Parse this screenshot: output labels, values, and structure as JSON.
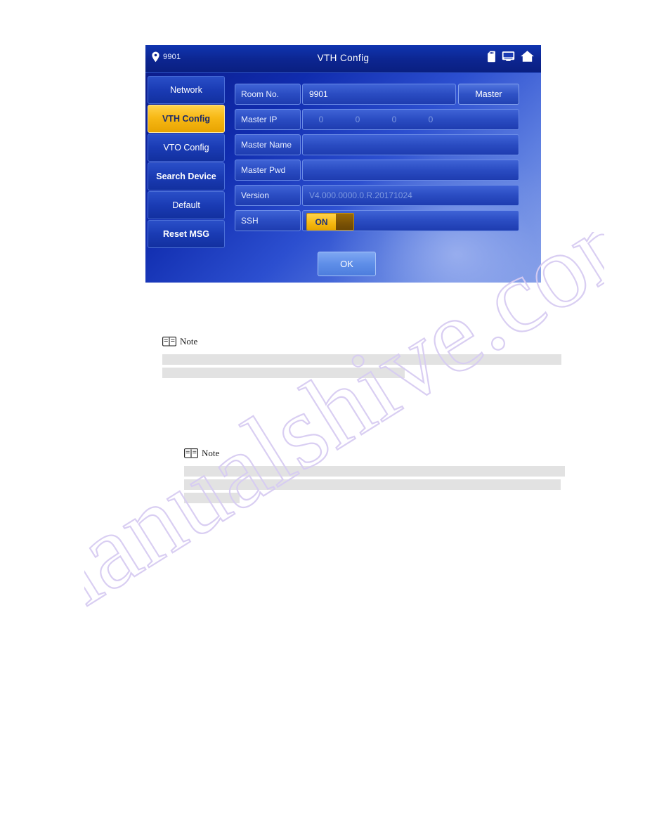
{
  "device": {
    "titlebar": {
      "room_number": "9901",
      "title": "VTH Config",
      "icons": [
        "sd-card-icon",
        "monitor-icon",
        "home-icon"
      ]
    },
    "menu": [
      {
        "label": "Network",
        "active": false,
        "bold": false
      },
      {
        "label": "VTH Config",
        "active": true,
        "bold": false
      },
      {
        "label": "VTO Config",
        "active": false,
        "bold": false
      },
      {
        "label": "Search Device",
        "active": false,
        "bold": true
      },
      {
        "label": "Default",
        "active": false,
        "bold": false
      },
      {
        "label": "Reset MSG",
        "active": false,
        "bold": true
      }
    ],
    "form": {
      "room_no": {
        "label": "Room No.",
        "value": "9901"
      },
      "master_button": "Master",
      "master_ip": {
        "label": "Master IP",
        "octets": [
          "0",
          "0",
          "0",
          "0"
        ]
      },
      "master_name": {
        "label": "Master Name",
        "value": ""
      },
      "master_pwd": {
        "label": "Master Pwd",
        "value": ""
      },
      "version": {
        "label": "Version",
        "value": "V4.000.0000.0.R.20171024"
      },
      "ssh": {
        "label": "SSH",
        "state": "ON"
      }
    },
    "ok_button": "OK"
  },
  "notes": [
    {
      "word": "Note"
    },
    {
      "word": "Note"
    }
  ],
  "watermark": {
    "text": "manualshive.com"
  },
  "colors": {
    "accent_yellow": "#f7b916",
    "panel_blue": "#2a4cc2",
    "title_blue": "#0c2590",
    "redact_gray": "#e2e2e2"
  }
}
